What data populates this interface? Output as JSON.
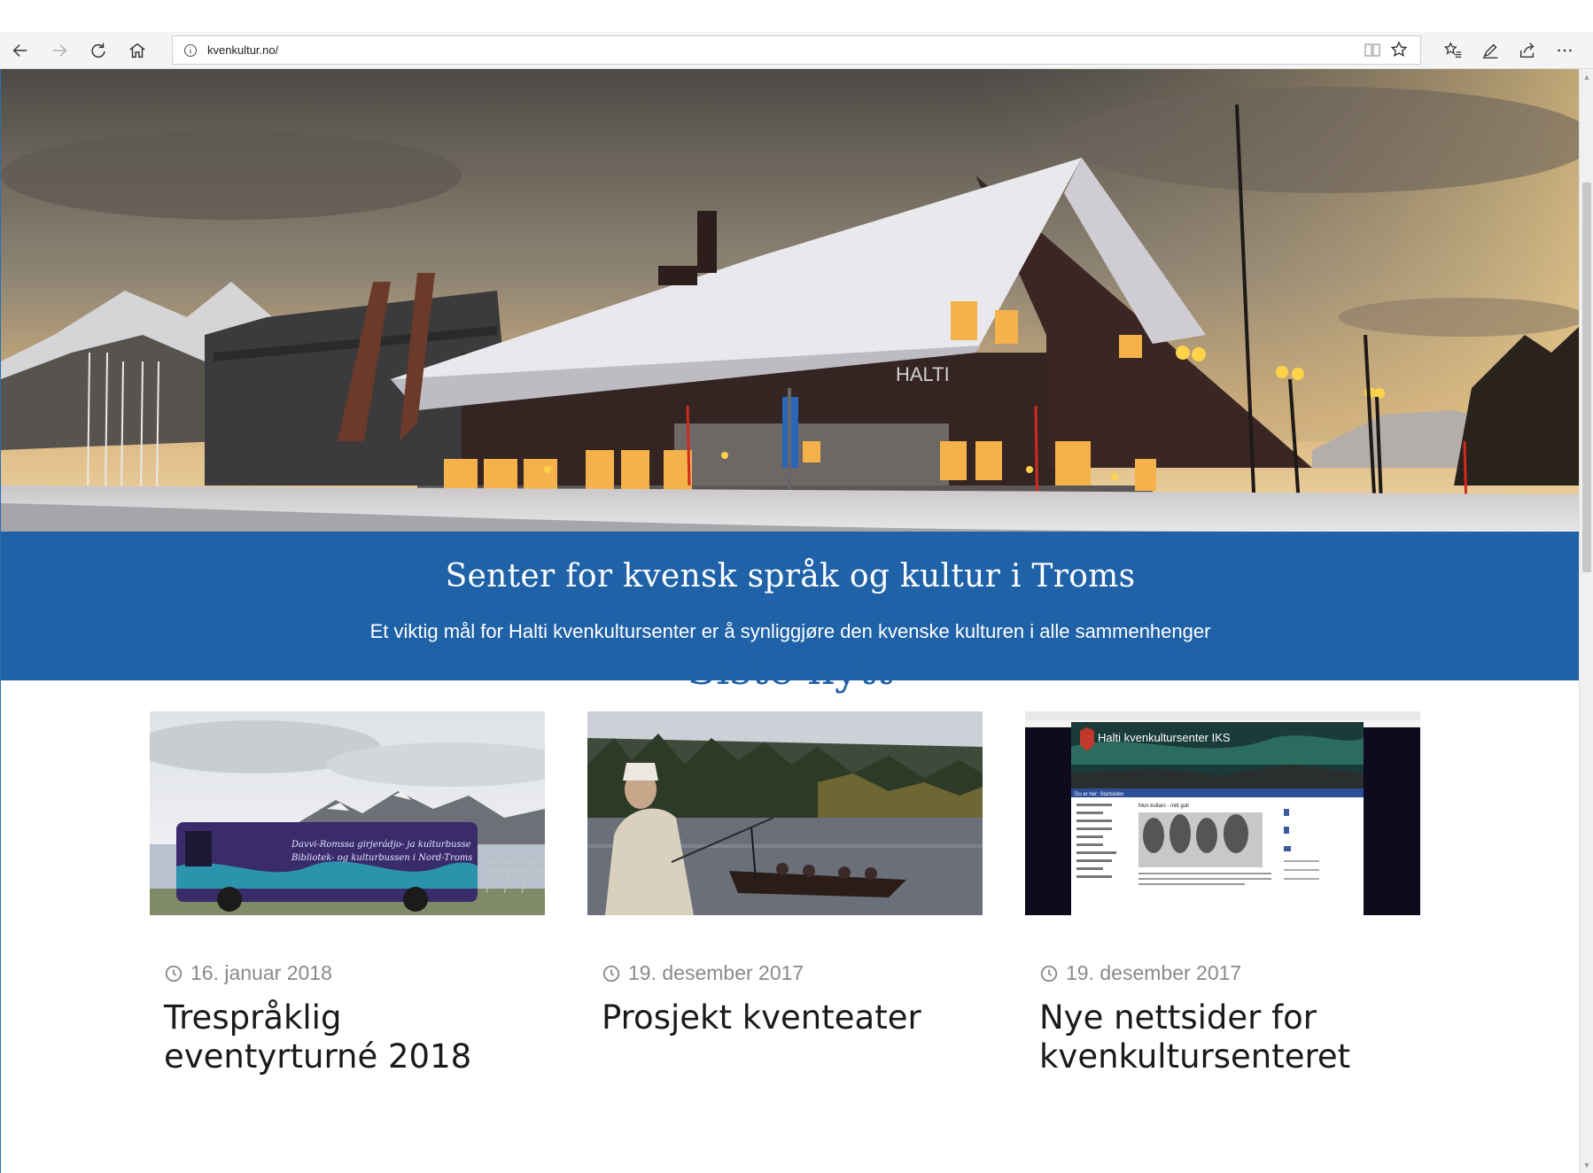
{
  "browser": {
    "url": "kvenkultur.no/",
    "nav_icons": [
      "back-icon",
      "forward-icon",
      "refresh-icon",
      "home-icon"
    ],
    "right_icons": [
      "favorites-icon",
      "pen-icon",
      "share-icon",
      "more-icon"
    ],
    "addr_icons": [
      "reading-view-icon",
      "star-icon"
    ]
  },
  "banner": {
    "title": "Senter for kvensk språk og kultur i Troms",
    "subtitle": "Et viktig mål for Halti kvenkultursenter er å synliggjøre den kvenske kulturen i alle sammenhenger",
    "color": "#1f62a7"
  },
  "hero": {
    "sign_text": "HALTI"
  },
  "news": {
    "heading": "Siste nytt",
    "items": [
      {
        "date": "16. januar 2018",
        "title": "Trespråklig eventyrturné 2018",
        "image": "bus-photo"
      },
      {
        "date": "19. desember 2017",
        "title": "Prosjekt kventeater",
        "image": "river-boat-photo"
      },
      {
        "date": "19. desember 2017",
        "title": "Nye nettsider for kvenkultursenteret",
        "image": "website-screenshot",
        "thumb_text": {
          "site_title": "Halti kvenkultursenter IKS",
          "breadcrumb": "Du er her: Startsiden",
          "article_title": "Mun kultani - mitt gull"
        }
      }
    ]
  }
}
